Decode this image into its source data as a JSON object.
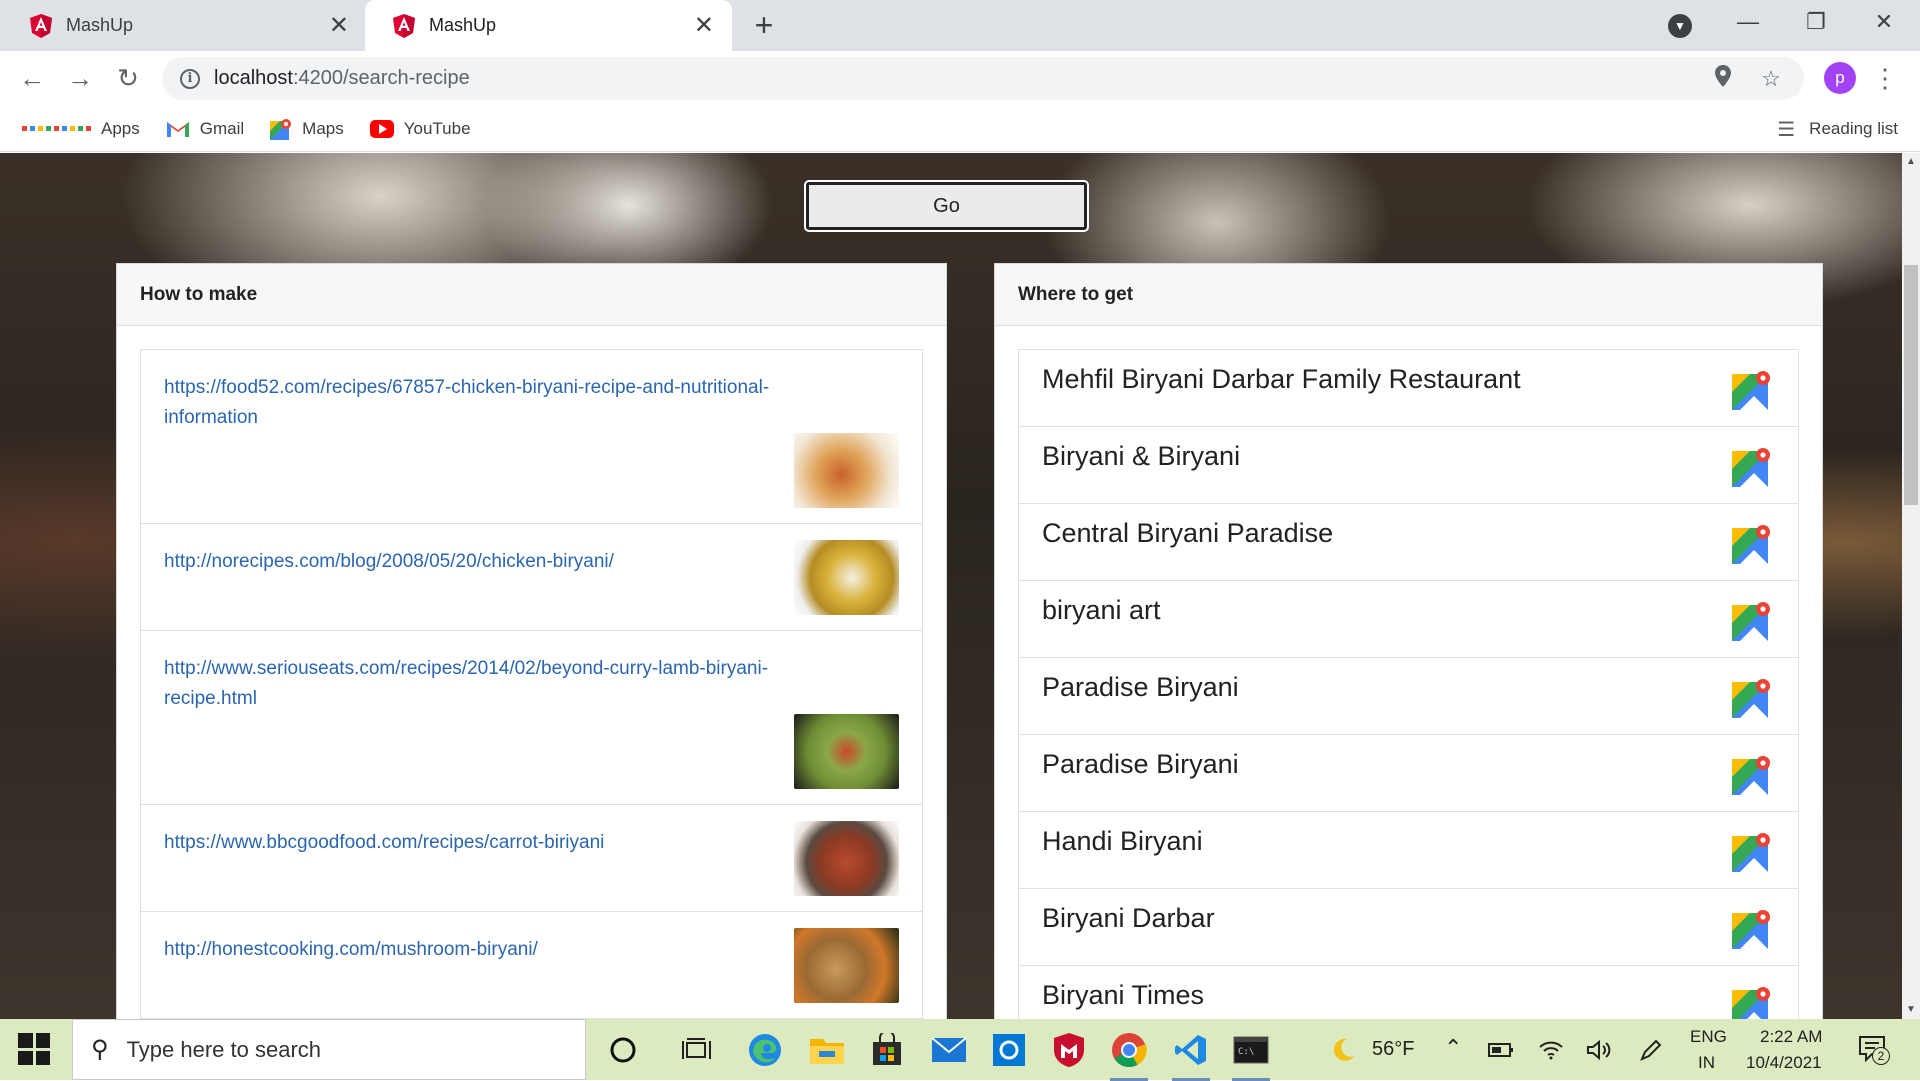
{
  "browser": {
    "tabs": [
      {
        "title": "MashUp",
        "active": false
      },
      {
        "title": "MashUp",
        "active": true
      }
    ],
    "new_tab_label": "+",
    "window_controls": {
      "minimize": "—",
      "restore": "❐",
      "close": "✕"
    },
    "address": {
      "host": "localhost",
      "path": ":4200/search-recipe"
    },
    "profile_initial": "p",
    "bookmarks": [
      {
        "label": "Apps",
        "icon": "apps-grid-icon"
      },
      {
        "label": "Gmail",
        "icon": "gmail-icon"
      },
      {
        "label": "Maps",
        "icon": "maps-icon"
      },
      {
        "label": "YouTube",
        "icon": "youtube-icon"
      }
    ],
    "reading_list_label": "Reading list"
  },
  "page": {
    "go_label": "Go",
    "how_to_make": {
      "title": "How to make",
      "recipes": [
        {
          "url": "https://food52.com/recipes/67857-chicken-biryani-recipe-and-nutritional-information"
        },
        {
          "url": "http://norecipes.com/blog/2008/05/20/chicken-biryani/"
        },
        {
          "url": "http://www.seriouseats.com/recipes/2014/02/beyond-curry-lamb-biryani-recipe.html"
        },
        {
          "url": "https://www.bbcgoodfood.com/recipes/carrot-biriyani"
        },
        {
          "url": "http://honestcooking.com/mushroom-biryani/"
        }
      ]
    },
    "where_to_get": {
      "title": "Where to get",
      "places": [
        "Mehfil Biryani Darbar Family Restaurant",
        "Biryani & Biryani",
        "Central Biryani Paradise",
        "biryani art",
        "Paradise Biryani",
        "Paradise Biryani",
        "Handi Biryani",
        "Biryani Darbar",
        "Biryani Times"
      ]
    }
  },
  "taskbar": {
    "search_placeholder": "Type here to search",
    "weather": "56°F",
    "language": "ENG",
    "region": "IN",
    "time": "2:22 AM",
    "date": "10/4/2021",
    "notification_count": "2"
  },
  "colors": {
    "link": "#2a66b0",
    "taskbar": "#dbeabf",
    "angular_red": "#dd0031"
  }
}
